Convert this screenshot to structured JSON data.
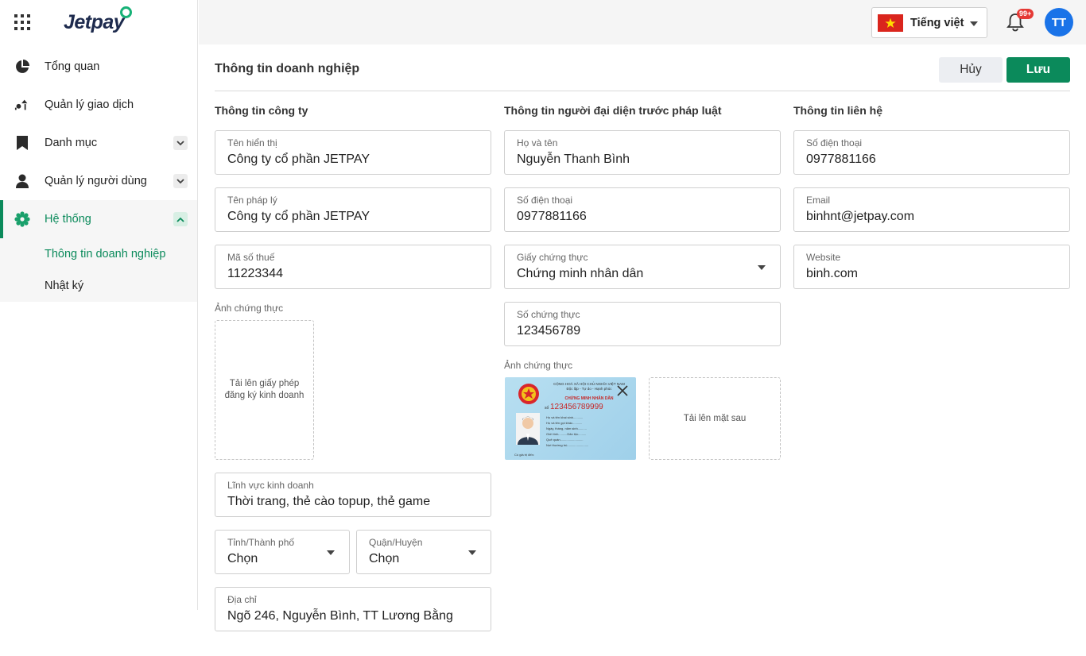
{
  "app": {
    "logo_text": "Jetpay"
  },
  "sidebar": {
    "items": [
      {
        "label": "Tổng quan",
        "icon": "pie-chart-icon"
      },
      {
        "label": "Quản lý giao dịch",
        "icon": "transactions-icon"
      },
      {
        "label": "Danh mục",
        "icon": "bookmark-icon",
        "expandable": true
      },
      {
        "label": "Quản lý người dùng",
        "icon": "user-icon",
        "expandable": true
      },
      {
        "label": "Hệ thống",
        "icon": "settings-gear-icon",
        "expandable": true,
        "expanded": true,
        "active": true
      }
    ],
    "sub_items": [
      {
        "label": "Thông tin doanh nghiệp",
        "active": true
      },
      {
        "label": "Nhật ký"
      }
    ]
  },
  "header": {
    "language": "Tiếng việt",
    "notification_badge": "99+",
    "avatar_initials": "TT"
  },
  "page": {
    "title": "Thông tin doanh nghiệp",
    "cancel_label": "Hủy",
    "save_label": "Lưu"
  },
  "company": {
    "section_title": "Thông tin công ty",
    "display_name": {
      "label": "Tên hiển thị",
      "value": "Công ty cổ phần JETPAY"
    },
    "legal_name": {
      "label": "Tên pháp lý",
      "value": "Công ty cổ phần JETPAY"
    },
    "tax_code": {
      "label": "Mã số thuế",
      "value": "11223344"
    },
    "cert_image_label": "Ảnh chứng thực",
    "upload_license_text": "Tải lên giấy phép đăng ký kinh doanh",
    "business_field": {
      "label": "Lĩnh vực kinh doanh",
      "value": "Thời trang, thẻ cào topup, thẻ game"
    },
    "province": {
      "label": "Tỉnh/Thành phố",
      "value": "Chọn"
    },
    "district": {
      "label": "Quận/Huyện",
      "value": "Chọn"
    },
    "address": {
      "label": "Địa chỉ",
      "value": "Ngõ 246, Nguyễn Bình, TT Lương Bằng"
    }
  },
  "representative": {
    "section_title": "Thông tin người đại diện trước pháp luật",
    "full_name": {
      "label": "Họ và tên",
      "value": "Nguyễn Thanh Bình"
    },
    "phone": {
      "label": "Số điện thoại",
      "value": "0977881166"
    },
    "document_type": {
      "label": "Giấy chứng thực",
      "value": "Chứng minh nhân dân"
    },
    "document_number": {
      "label": "Số chứng thực",
      "value": "123456789"
    },
    "cert_image_label": "Ảnh chứng thực",
    "id_card": {
      "header": "CỘNG HOÀ XÃ HỘI CHỦ NGHĨA VIỆT NAM",
      "motto": "Độc lập - Tự do - Hạnh phúc",
      "card_title": "CHỨNG MINH NHÂN DÂN",
      "number_prefix": "số",
      "number": "123456789999",
      "lines": [
        "Họ và tên khai sinh...........",
        "Họ và tên gọi khác...........",
        "Ngày, tháng, năm sinh..........",
        "Giới tính..........Dân tộc.........",
        "Quê quán..........................",
        "Nơi thường trú........................"
      ],
      "footer": "Có giá trị đến:"
    },
    "upload_back_text": "Tải lên mặt sau"
  },
  "contact": {
    "section_title": "Thông tin liên hệ",
    "phone": {
      "label": "Số điện thoại",
      "value": "0977881166"
    },
    "email": {
      "label": "Email",
      "value": "binhnt@jetpay.com"
    },
    "website": {
      "label": "Website",
      "value": "binh.com"
    }
  },
  "colors": {
    "brand_green": "#0b8a5b",
    "avatar_blue": "#1a73e8",
    "badge_red": "#e53935"
  }
}
